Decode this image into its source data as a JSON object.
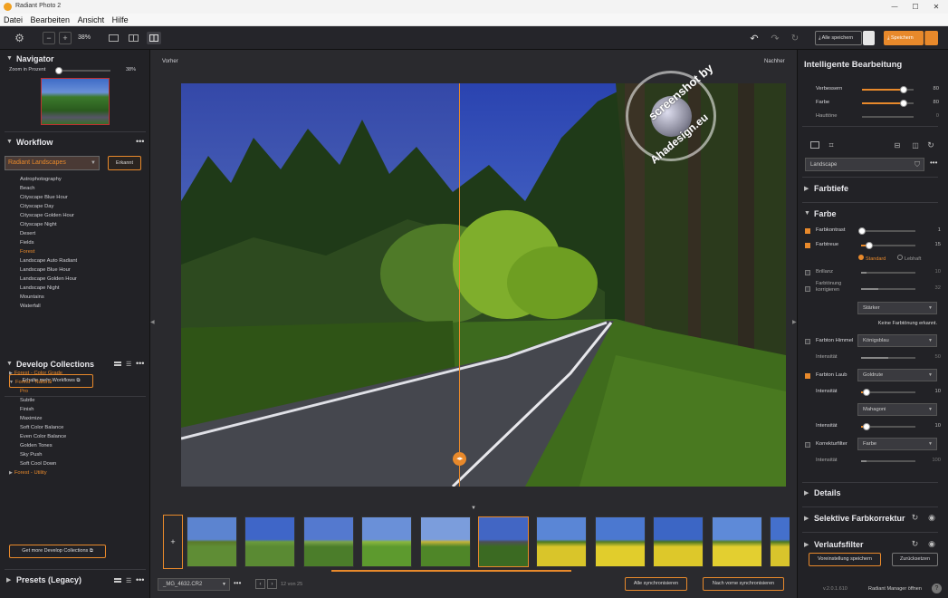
{
  "window": {
    "title": "Radiant Photo 2",
    "min": "—",
    "max": "☐",
    "close": "✕"
  },
  "menu": [
    "Datei",
    "Bearbeiten",
    "Ansicht",
    "Hilfe"
  ],
  "toolbar": {
    "zoom": "38%",
    "save_all": "Alle speichern",
    "save": "Speichern"
  },
  "navigator": {
    "title": "Navigator",
    "zoom_label": "Zoom in Prozent",
    "zoom_value": "38%",
    "zoom_fraction": 0.05
  },
  "workflow": {
    "title": "Workflow",
    "select": "Radiant Landscapes",
    "detected": "Erkannt",
    "items": [
      "Astrophotography",
      "Beach",
      "Cityscape Blue Hour",
      "Cityscape Day",
      "Cityscape Golden Hour",
      "Cityscape Night",
      "Desert",
      "Fields",
      "Forest",
      "Landscape Auto Radiant",
      "Landscape Blue Hour",
      "Landscape Golden Hour",
      "Landscape Night",
      "Mountains",
      "Waterfall"
    ],
    "active": "Forest",
    "more": "Erhalte mehr Workflows"
  },
  "collections": {
    "title": "Develop Collections",
    "groups": [
      {
        "label": "Forest - Color Grade",
        "expanded": false
      },
      {
        "label": "Forest - Natural",
        "expanded": true
      }
    ],
    "items": [
      "Pro",
      "Subtle",
      "Finish",
      "Maximize",
      "Soft Color Balance",
      "Even Color Balance",
      "Golden Tones",
      "Sky Push",
      "Soft Cool Down"
    ],
    "active_item": "Pro",
    "utility": "Forest - Utility",
    "more": "Get more Develop Collections"
  },
  "presets": {
    "title": "Presets (Legacy)"
  },
  "preview": {
    "before": "Vorher",
    "after": "Nachher",
    "split_fraction": 0.46
  },
  "watermark": {
    "line1": "screenshot by",
    "line2": "Ahadesign.eu"
  },
  "filmstrip": {
    "filename": "_MG_4632.CR2",
    "counter": "12 von 25",
    "sync_all": "Alle synchronisieren",
    "sync_prev": "Nach vorne synchronisieren",
    "add": "+",
    "count": 11,
    "selected_index": 5
  },
  "right": {
    "title": "Intelligente Bearbeitung",
    "sliders": [
      {
        "label": "Verbessern",
        "value": "80",
        "fraction": 0.8
      },
      {
        "label": "Farbe",
        "value": "80",
        "fraction": 0.8
      },
      {
        "label": "Hauttöne",
        "value": "0",
        "fraction": 0
      }
    ],
    "preset_select": "Landscape",
    "farbtiefe": "Farbtiefe",
    "farbe": "Farbe",
    "farbkontrast": {
      "label": "Farbkontrast",
      "value": "1",
      "fraction": 0.02
    },
    "farbtreue": {
      "label": "Farbtreue",
      "value": "15",
      "fraction": 0.15
    },
    "radio_standard": "Standard",
    "radio_lebhaft": "Lebhaft",
    "brillanz": {
      "label": "Brillanz",
      "value": "10",
      "fraction": 0.1
    },
    "farbtoenung": {
      "label": "Farbtönung korrigieren",
      "value": "32",
      "fraction": 0.32
    },
    "staerke_select": "Stärker",
    "no_tint": "Keine Farbtönung erkannt.",
    "himmel": {
      "label": "Farbton Himmel",
      "select": "Königsblau"
    },
    "intensitaet1": {
      "label": "Intensität",
      "value": "50",
      "fraction": 0.5
    },
    "laub": {
      "label": "Farbton Laub",
      "select": "Goldrute"
    },
    "intensitaet2": {
      "label": "Intensität",
      "value": "10",
      "fraction": 0.1
    },
    "laub2_select": "Mahagoni",
    "intensitaet3": {
      "label": "Intensität",
      "value": "10",
      "fraction": 0.1
    },
    "korrektur": {
      "label": "Korrekturfilter",
      "select": "Farbe"
    },
    "intensitaet4": {
      "label": "Intensität",
      "value": "100",
      "fraction": 0.1
    },
    "details": "Details",
    "selektiv": "Selektive Farbkorrektur",
    "verlauf": "Verlaufsfilter",
    "save_preset": "Voreinstellung speichern",
    "reset": "Zurücksetzen",
    "version": "v.2.0.1.610",
    "manager": "Radiant Manager öffnen"
  },
  "colors": {
    "accent": "#e8892b",
    "panel": "#222226",
    "bg": "#1b1b1f"
  }
}
